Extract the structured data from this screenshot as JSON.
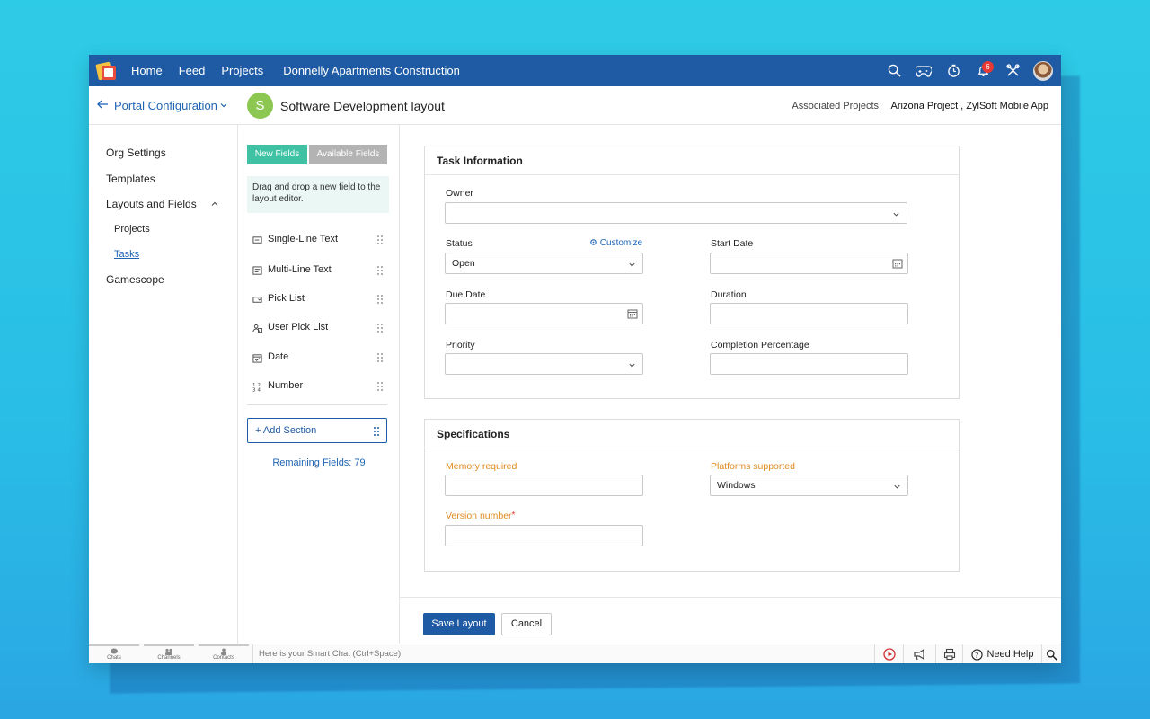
{
  "nav": {
    "home": "Home",
    "feed": "Feed",
    "projects": "Projects",
    "current_project": "Donnelly Apartments Construction",
    "notification_count": "6"
  },
  "header": {
    "portal_config": "Portal Configuration",
    "layout_initial": "S",
    "layout_title": "Software Development layout",
    "associated_label": "Associated Projects:",
    "associated_projects": "Arizona Project ,  ZylSoft Mobile App"
  },
  "sidebar": {
    "items": [
      {
        "label": "Org Settings"
      },
      {
        "label": "Templates"
      },
      {
        "label": "Layouts and Fields"
      },
      {
        "label": "Projects"
      },
      {
        "label": "Tasks"
      },
      {
        "label": "Gamescope"
      }
    ]
  },
  "fields_panel": {
    "tab_new": "New Fields",
    "tab_available": "Available Fields",
    "hint": "Drag and drop a new field to the layout editor.",
    "fields": [
      {
        "label": "Single-Line Text",
        "icon": "single-line-text-icon"
      },
      {
        "label": "Multi-Line Text",
        "icon": "multi-line-text-icon"
      },
      {
        "label": "Pick List",
        "icon": "pick-list-icon"
      },
      {
        "label": "User Pick List",
        "icon": "user-pick-list-icon"
      },
      {
        "label": "Date",
        "icon": "date-icon"
      },
      {
        "label": "Number",
        "icon": "number-icon"
      }
    ],
    "add_section": "+ Add Section",
    "remaining": "Remaining Fields: 79"
  },
  "task_info": {
    "title": "Task Information",
    "owner_label": "Owner",
    "owner_value": "",
    "status_label": "Status",
    "customize": "Customize",
    "status_value": "Open",
    "start_date_label": "Start Date",
    "due_date_label": "Due Date",
    "duration_label": "Duration",
    "priority_label": "Priority",
    "completion_label": "Completion Percentage"
  },
  "specs": {
    "title": "Specifications",
    "memory_label": "Memory required",
    "platforms_label": "Platforms supported",
    "platforms_value": "Windows",
    "version_label": "Version number",
    "required_mark": "*"
  },
  "footer": {
    "save": "Save Layout",
    "cancel": "Cancel"
  },
  "chatbar": {
    "chats": "Chats",
    "channels": "Channels",
    "contacts": "Contacts",
    "smart_chat_placeholder": "Here is your Smart Chat (Ctrl+Space)",
    "need_help": "Need Help"
  },
  "colors": {
    "brand": "#1f5aa5",
    "accent_green": "#3ec2a3",
    "orange_label": "#e08a1e",
    "badge_red": "#e53935"
  }
}
